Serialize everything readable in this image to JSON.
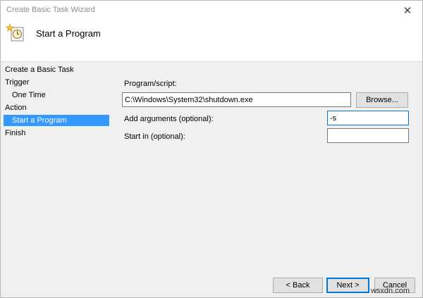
{
  "window": {
    "title": "Create Basic Task Wizard",
    "close_glyph": "✕",
    "icon": "clock-icon"
  },
  "header": {
    "title": "Start a Program"
  },
  "sidebar": {
    "steps": [
      {
        "label": "Create a Basic Task",
        "level": 0,
        "selected": false
      },
      {
        "label": "Trigger",
        "level": 0,
        "selected": false
      },
      {
        "label": "One Time",
        "level": 1,
        "selected": false
      },
      {
        "label": "Action",
        "level": 0,
        "selected": false
      },
      {
        "label": "Start a Program",
        "level": 1,
        "selected": true
      },
      {
        "label": "Finish",
        "level": 0,
        "selected": false
      }
    ]
  },
  "form": {
    "program_label": "Program/script:",
    "program_value": "C:\\Windows\\System32\\shutdown.exe",
    "browse_label": "Browse...",
    "args_label": "Add arguments (optional):",
    "args_value": "-s",
    "startin_label": "Start in (optional):",
    "startin_value": ""
  },
  "footer": {
    "back_label": "< Back",
    "next_label": "Next >",
    "cancel_label": "Cancel"
  },
  "watermark": "wsxdn.com",
  "colors": {
    "selection": "#3399ff",
    "focus_border": "#0078d7",
    "panel_bg": "#f0f0f0"
  }
}
